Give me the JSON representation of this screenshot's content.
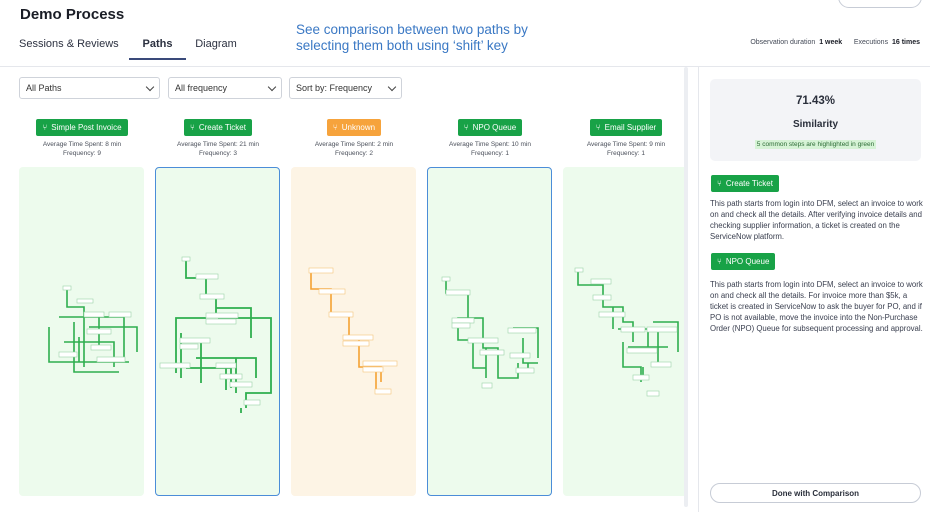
{
  "header": {
    "title": "Demo Process",
    "annotation": "See comparison between two paths by selecting them both using ‘shift’ key"
  },
  "tabs": [
    {
      "label": "Sessions & Reviews"
    },
    {
      "label": "Paths",
      "active": true
    },
    {
      "label": "Diagram"
    }
  ],
  "meta": {
    "obs_label": "Observation duration",
    "obs_value": "1 week",
    "exec_label": "Executions",
    "exec_value": "16 times"
  },
  "filters": {
    "paths": "All Paths",
    "frequency": "All frequency",
    "sort": "Sort by: Frequency"
  },
  "columns": [
    {
      "name": "Simple Post Invoice",
      "time": "Average Time Spent: 8 min",
      "freq": "Frequency: 9",
      "color": "green",
      "selected": false
    },
    {
      "name": "Create Ticket",
      "time": "Average Time Spent: 21 min",
      "freq": "Frequency: 3",
      "color": "green",
      "selected": true
    },
    {
      "name": "Unknown",
      "time": "Average Time Spent: 2 min",
      "freq": "Frequency: 2",
      "color": "orange",
      "selected": false
    },
    {
      "name": "NPO Queue",
      "time": "Average Time Spent: 10 min",
      "freq": "Frequency: 1",
      "color": "green",
      "selected": true
    },
    {
      "name": "Email Supplier",
      "time": "Average Time Spent: 9 min",
      "freq": "Frequency: 1",
      "color": "green",
      "selected": false
    }
  ],
  "comparison": {
    "similarity_pct": "71.43%",
    "similarity_label": "Similarity",
    "note": "5 common steps are highlighted in green",
    "path_a": {
      "name": "Create Ticket",
      "description": "This path starts from login into DFM, select an invoice to work on and check all the details. After verifying invoice details and checking supplier information, a ticket is created on the ServiceNow platform."
    },
    "path_b": {
      "name": "NPO Queue",
      "description": "This path starts from login into DFM, select an invoice to work on and check all the details. For invoice more than $5k, a ticket is created in ServiceNow to ask the buyer for PO, and if PO is not available, move the invoice into the Non-Purchase Order (NPO) Queue for subsequent processing and approval."
    },
    "done_label": "Done with Comparison"
  },
  "colors": {
    "accent_green": "#18a247",
    "accent_orange": "#f6a33c",
    "selection_blue": "#4b8dd8",
    "annotation_blue": "#3a78c4"
  },
  "icons": {
    "path_chip": "branch-icon",
    "dropdown": "chevron-down-icon"
  }
}
